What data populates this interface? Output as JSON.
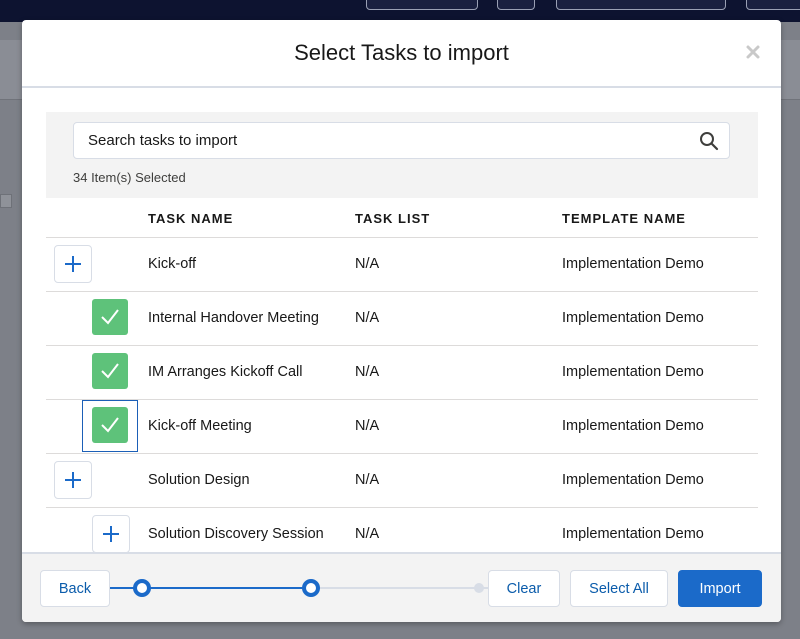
{
  "modal": {
    "title": "Select Tasks to import"
  },
  "search": {
    "placeholder": "Search tasks to import"
  },
  "selection": {
    "count_text": "34 Item(s) Selected"
  },
  "table": {
    "headers": [
      "TASK NAME",
      "TASK LIST",
      "TEMPLATE NAME"
    ],
    "rows": [
      {
        "task_name": "Kick-off",
        "task_list": "N/A",
        "template_name": "Implementation Demo",
        "control": "plus-button"
      },
      {
        "task_name": "Internal Handover Meeting",
        "task_list": "N/A",
        "template_name": "Implementation Demo",
        "control": "checked"
      },
      {
        "task_name": "IM Arranges Kickoff Call",
        "task_list": "N/A",
        "template_name": "Implementation Demo",
        "control": "checked"
      },
      {
        "task_name": "Kick-off Meeting",
        "task_list": "N/A",
        "template_name": "Implementation Demo",
        "control": "checked-focused"
      },
      {
        "task_name": "Solution Design",
        "task_list": "N/A",
        "template_name": "Implementation Demo",
        "control": "plus-button"
      },
      {
        "task_name": "Solution Discovery Session",
        "task_list": "N/A",
        "template_name": "Implementation Demo",
        "control": "plus-button"
      }
    ]
  },
  "footer": {
    "back_label": "Back",
    "clear_label": "Clear",
    "select_all_label": "Select All",
    "import_label": "Import",
    "progress": {
      "steps_total": 3,
      "current_step": 2
    }
  },
  "colors": {
    "primary": "#1b6ac9",
    "check_green": "#5ec27a",
    "header_bg": "#ffffff",
    "footer_bg": "#f3f3f3"
  },
  "icons": {
    "close": "close-icon",
    "search": "search-icon",
    "add": "plus-icon",
    "check": "checkmark-icon"
  }
}
